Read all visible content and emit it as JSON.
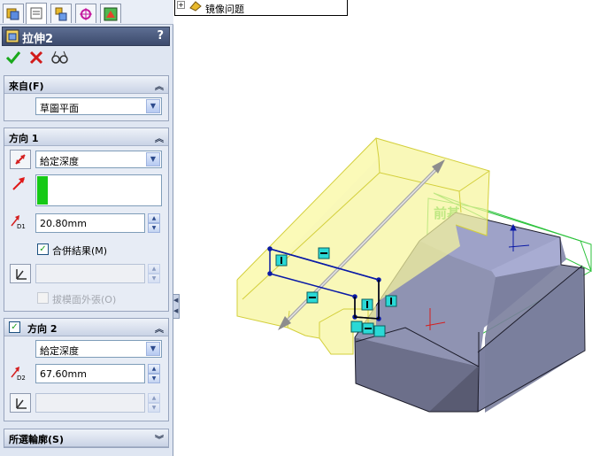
{
  "feature": {
    "title": "拉伸2",
    "help": "?"
  },
  "tree": {
    "item_label": "镜像问题",
    "expander": "+"
  },
  "from_section": {
    "header": "來自(F)",
    "start_condition": "草圖平面"
  },
  "direction1": {
    "header": "方向 1",
    "end_condition": "給定深度",
    "depth_label": "D1",
    "depth_value": "20.80mm",
    "merge_label": "合併結果(M)",
    "merge_checked": true,
    "draft_label": "拔模面外張(O)",
    "draft_checked": false
  },
  "direction2": {
    "header": "方向 2",
    "enabled": true,
    "end_condition": "給定深度",
    "depth_label": "D2",
    "depth_value": "67.60mm"
  },
  "selected_contours": {
    "header": "所選輪廓(S)"
  },
  "viewport": {
    "plane_label": "前基",
    "colors": {
      "preview_fill": "#f7f59c",
      "preview_edge": "#d3cf3b",
      "solid_top": "#9ea2c8",
      "solid_side": "#7a7e9c",
      "sketch": "#0a1aa6",
      "plane": "#2bc23b",
      "handle": "#2ad9d6"
    }
  },
  "icons": {
    "ok": "check-icon",
    "cancel": "cancel-icon",
    "preview": "glasses-icon"
  }
}
